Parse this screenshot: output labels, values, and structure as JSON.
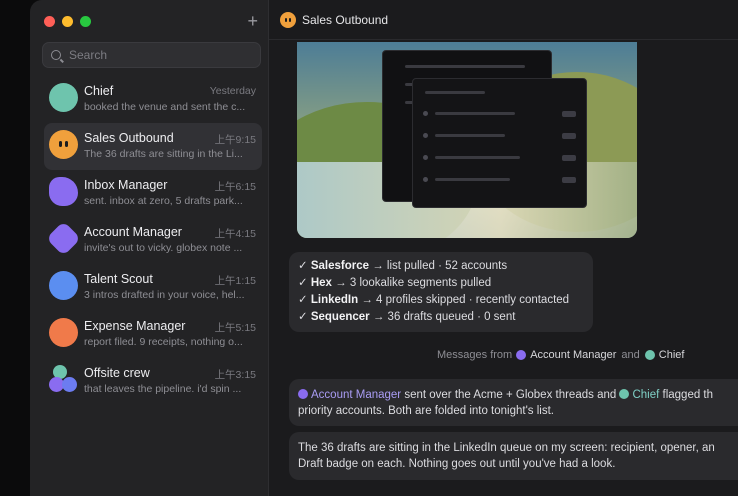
{
  "window": {
    "title": "Sales Outbound"
  },
  "sidebar": {
    "new_label": "+",
    "search": {
      "placeholder": "Search"
    },
    "conversations": [
      {
        "name": "Chief",
        "time": "Yesterday",
        "preview": "booked the venue and sent the c...",
        "avatar_color": "#6ec4ad"
      },
      {
        "name": "Sales Outbound",
        "time": "上午9:15",
        "preview": "The 36 drafts are sitting in the Li...",
        "avatar_color": "#f0a03c"
      },
      {
        "name": "Inbox Manager",
        "time": "上午6:15",
        "preview": "sent. inbox at zero, 5 drafts park...",
        "avatar_color": "#8a6cf0"
      },
      {
        "name": "Account Manager",
        "time": "上午4:15",
        "preview": "invite's out to vicky. globex note ...",
        "avatar_color": "#8a6cf0"
      },
      {
        "name": "Talent Scout",
        "time": "上午1:15",
        "preview": "3 intros drafted in your voice, hel...",
        "avatar_color": "#5b8ef0"
      },
      {
        "name": "Expense Manager",
        "time": "上午5:15",
        "preview": "report filed. 9 receipts, nothing o...",
        "avatar_color": "#f07a4a"
      },
      {
        "name": "Offsite crew",
        "time": "上午3:15",
        "preview": "that leaves the pipeline. i'd spin ...",
        "avatar_color": "#8a6cf0"
      }
    ]
  },
  "main": {
    "checklist": [
      {
        "mark": "✓",
        "tool": "Salesforce",
        "detail": "→ list pulled · 52 accounts"
      },
      {
        "mark": "✓",
        "tool": "Hex",
        "detail": "→ 3 lookalike segments pulled"
      },
      {
        "mark": "✓",
        "tool": "LinkedIn",
        "detail": "→ 4 profiles skipped · recently contacted"
      },
      {
        "mark": "✓",
        "tool": "Sequencer",
        "detail": "→ 36 drafts queued · 0 sent"
      }
    ],
    "messages_from": {
      "prefix": "Messages from",
      "first": "Account Manager",
      "joiner": "and",
      "second": "Chief"
    },
    "message1": {
      "mention1": "Account Manager",
      "text1": " sent over the Acme + Globex threads and ",
      "mention2": "Chief",
      "text2": " flagged th",
      "line2": "priority accounts. Both are folded into tonight's list."
    },
    "message2": {
      "line1": "The 36 drafts are sitting in the LinkedIn queue on my screen: recipient, opener, an",
      "line2": "Draft badge on each. Nothing goes out until you've had a look."
    }
  }
}
